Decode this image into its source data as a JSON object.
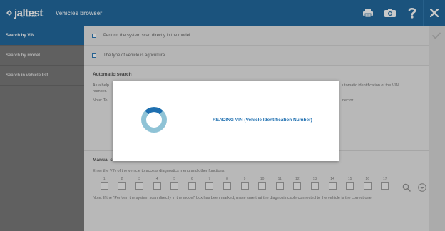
{
  "header": {
    "logo_text": "jaltest",
    "logo_sub": "by COJALI",
    "app_title": "Vehicles browser",
    "icons": [
      "printer-icon",
      "camera-icon",
      "help-icon",
      "close-icon"
    ]
  },
  "sidebar": {
    "items": [
      {
        "label": "Search by VIN",
        "active": true
      },
      {
        "label": "Search by model",
        "active": false
      },
      {
        "label": "Search in vehicle list",
        "active": false
      }
    ]
  },
  "options": {
    "scan_in_model": "Perform the system scan directly in the model.",
    "agricultural": "The type of vehicle is agricultural"
  },
  "automatic": {
    "title": "Automatic search",
    "text_left": "As a help",
    "text_left_2": "number.",
    "text_right": "utomatic identification of the VIN",
    "note_left": "Note: To",
    "note_right": "nector."
  },
  "manual": {
    "title": "Manual search",
    "instructions": "Enter the VIN of the vehicle to access diagnostics menu and other functions.",
    "vin_positions": [
      "1",
      "2",
      "3",
      "4",
      "5",
      "6",
      "7",
      "8",
      "9",
      "10",
      "11",
      "12",
      "13",
      "14",
      "15",
      "16",
      "17"
    ],
    "note": "Note: If the \"Perform the system scan directly in the model\" box has been marked, make sure that the diagnosis cable connected to the vehicle is the correct one."
  },
  "modal": {
    "message": "READING VIN (Vehicle Identification Number)"
  },
  "colors": {
    "brand_blue": "#0e5c96",
    "accent_blue": "#1e6fb0",
    "spinner_light": "#8fc3d6",
    "spinner_dark": "#1e6fb0"
  }
}
